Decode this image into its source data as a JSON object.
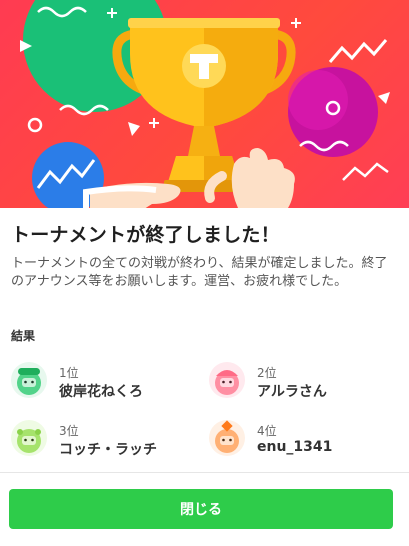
{
  "dialog": {
    "title": "トーナメントが終了しました！",
    "description": "トーナメントの全ての対戦が終わり、結果が確定しました。終了のアナウンス等をお願いします。運営、お疲れ様でした。",
    "results_heading": "結果",
    "results": [
      {
        "rank": "1位",
        "name": "彼岸花ねくろ",
        "avatar_color": "#52d38a"
      },
      {
        "rank": "2位",
        "name": "アルラさん",
        "avatar_color": "#ff8fa3"
      },
      {
        "rank": "3位",
        "name": "コッチ・ラッチ",
        "avatar_color": "#a6e36c"
      },
      {
        "rank": "4位",
        "name": "enu_1341",
        "avatar_color": "#ffb074"
      }
    ],
    "close_label": "閉じる"
  },
  "colors": {
    "hero_background": "#ff3f4d",
    "button": "#2ecc4a",
    "trophy": "#ffc21c"
  }
}
